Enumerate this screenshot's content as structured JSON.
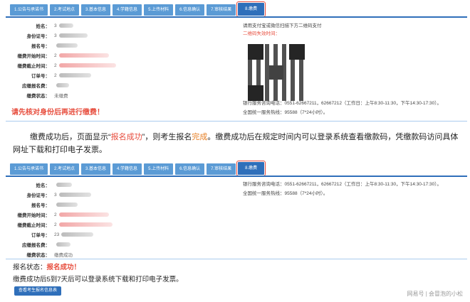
{
  "tabs": [
    "1.公告与承诺书",
    "2.考试地点",
    "3.基本信息",
    "4.学籍信息",
    "5.上传材料",
    "6.信息确认",
    "7.审核结果",
    "8.缴费"
  ],
  "active_tab_index": 7,
  "panel1": {
    "fields": [
      {
        "label": "姓名：",
        "value": "3",
        "blur": "gray",
        "blur_w": 20
      },
      {
        "label": "身份证号：",
        "value": "3",
        "blur": "gray",
        "blur_w": 40
      },
      {
        "label": "报名号：",
        "value": "",
        "blur": "gray",
        "blur_w": 30
      },
      {
        "label": "缴费开始时间：",
        "value": "2",
        "blur": "pink",
        "blur_w": 70
      },
      {
        "label": "缴费截止时间：",
        "value": "2",
        "blur": "pink",
        "blur_w": 80
      },
      {
        "label": "订单号：",
        "value": "2",
        "blur": "gray",
        "blur_w": 45
      },
      {
        "label": "应缴报名费：",
        "value": "",
        "blur": "gray",
        "blur_w": 18
      },
      {
        "label": "缴费状态：",
        "value": "未缴费",
        "blur": "none",
        "blur_w": 0
      }
    ],
    "warning": "请先核对身份后再进行缴费！",
    "pay_instruction": "请用支付宝或微信扫描下方二维码支付",
    "qr_expire": "二维码失效时间：",
    "bank_phone": "银行服务咨询电话：0551-62667211，62667212（工作日：上午8:30-11:30，下午14:30-17:30）。",
    "hotline": "全国统一服务热线：95588（7*24小时）。"
  },
  "paragraph": {
    "p1": "缴费成功后，页面显示“",
    "p2": "报名成功",
    "p3": "”，则考生报名",
    "p4": "完成",
    "p5": "。缴费成功后在规定时间内可以登录系统查看缴款码，凭缴款码访问具体网址下载和打印电子发票。"
  },
  "panel2": {
    "fields": [
      {
        "label": "姓名：",
        "value": "",
        "blur": "gray",
        "blur_w": 22
      },
      {
        "label": "身份证号：",
        "value": "3",
        "blur": "gray",
        "blur_w": 45
      },
      {
        "label": "报名号：",
        "value": "",
        "blur": "gray",
        "blur_w": 30
      },
      {
        "label": "缴费开始时间：",
        "value": "2",
        "blur": "pink",
        "blur_w": 70
      },
      {
        "label": "缴费截止时间：",
        "value": "2",
        "blur": "pink",
        "blur_w": 75
      },
      {
        "label": "订单号：",
        "value": "23",
        "blur": "gray",
        "blur_w": 45
      },
      {
        "label": "应缴报名费：",
        "value": "",
        "blur": "gray",
        "blur_w": 20
      },
      {
        "label": "缴费状态：",
        "value": "缴费成功",
        "blur": "none",
        "blur_w": 0
      }
    ],
    "bank_phone": "银行服务咨询电话：0551-62667211，62667212（工作日：上午8:30-11:30，下午14:30-17:30）。",
    "hotline": "全国统一服务热线：95588（7*24小时）。",
    "status_label": "报名状态：",
    "status_value": "报名成功！",
    "download_tip": "缴费成功后5到7天后可以登录系统下载和打印电子发票。",
    "print_button": "查看考生报名信息表"
  },
  "watermark": "网易号 | 会冒泡的小松",
  "colors": {
    "accent": "#2f6fba",
    "tab": "#5b9bd5",
    "red": "#e74c3c",
    "orange": "#e67e22"
  }
}
